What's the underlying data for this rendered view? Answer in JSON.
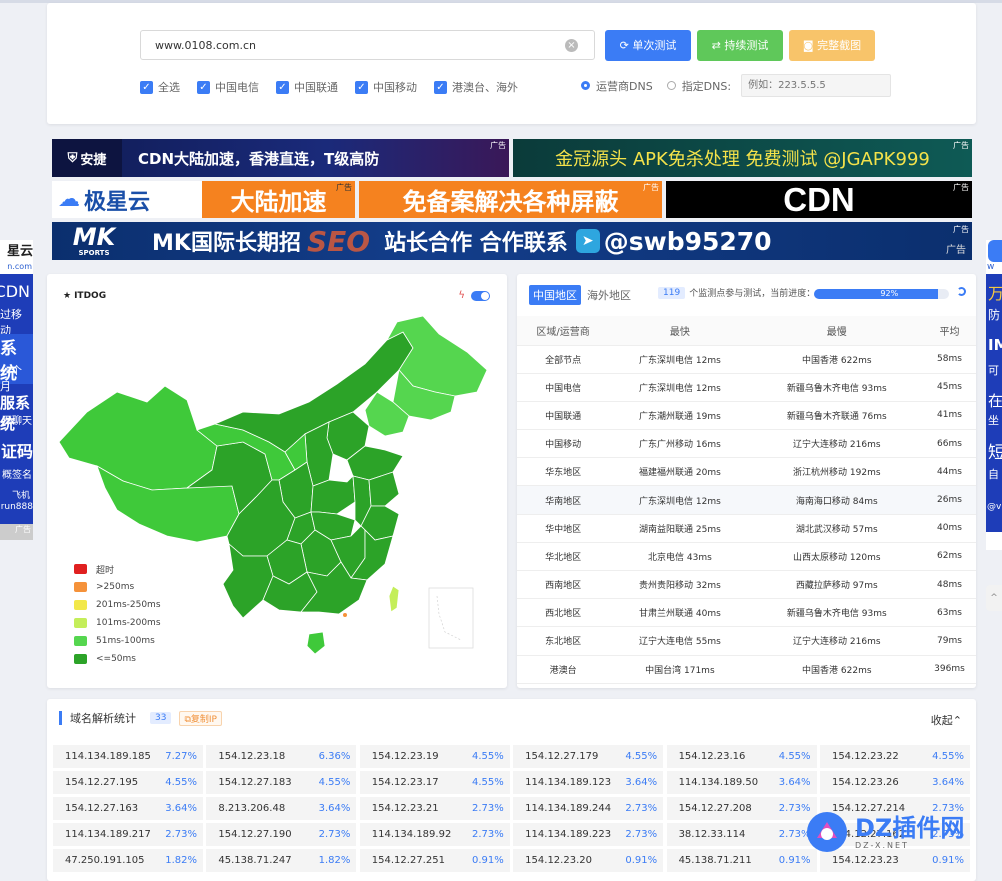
{
  "search": {
    "url_value": "www.0108.com.cn",
    "single_test": "单次测试",
    "continuous_test": "持续测试",
    "full_screenshot": "完整截图",
    "checkboxes": [
      "全选",
      "中国电信",
      "中国联通",
      "中国移动",
      "港澳台、海外"
    ],
    "dns_operator": "运营商DNS",
    "dns_custom": "指定DNS:",
    "dns_placeholder": "例如：223.5.5.5"
  },
  "ads": {
    "tag": "广告",
    "row1_left": "CDN大陆加速，香港直连，T级高防",
    "row1_left_brand": "安捷",
    "row1_right": "金冠源头 APK免杀处理 免费测试 @JGAPK999",
    "row2_left_brand": "极星云",
    "row2_left": "大陆加速",
    "row2_mid": "免备案解决各种屏蔽",
    "row2_right": "CDN",
    "row3_brand": "MK",
    "row3_brand_sub": "SPORTS",
    "row3": "MK国际长期招",
    "row3_seo": "SEO",
    "row3_b": "站长合作 合作联系",
    "row3_handle": "@swb95270",
    "left_side": [
      "星云",
      "n.com",
      "CDN",
      "过移动",
      "系统",
      "一个月",
      "服系统",
      "页聊天",
      "证码",
      "概签名",
      "飞机",
      "run888",
      "广告"
    ],
    "right_side": [
      "w",
      "万",
      "防",
      "IM",
      "可",
      "在",
      "坐",
      "短",
      "自",
      "@v"
    ]
  },
  "map": {
    "logo": "ITDOG",
    "legend": [
      "超时",
      ">250ms",
      "201ms-250ms",
      "101ms-200ms",
      "51ms-100ms",
      "<=50ms"
    ],
    "legend_colors": [
      "#e02020",
      "#f5923a",
      "#f2e84a",
      "#c4ee5a",
      "#55d64f",
      "#2ca328"
    ]
  },
  "stats": {
    "tab_cn": "中国地区",
    "tab_overseas": "海外地区",
    "node_count": "119",
    "node_text": "个监测点参与测试，当前进度：",
    "progress": "92%",
    "progress_value": 0.92,
    "headers": [
      "区域/运营商",
      "最快",
      "最慢",
      "平均"
    ],
    "rows": [
      [
        "全部节点",
        "广东深圳电信 12ms",
        "中国香港 622ms",
        "58ms"
      ],
      [
        "中国电信",
        "广东深圳电信 12ms",
        "新疆乌鲁木齐电信 93ms",
        "45ms"
      ],
      [
        "中国联通",
        "广东潮州联通 19ms",
        "新疆乌鲁木齐联通 76ms",
        "41ms"
      ],
      [
        "中国移动",
        "广东广州移动 16ms",
        "辽宁大连移动 216ms",
        "66ms"
      ],
      [
        "华东地区",
        "福建福州联通 20ms",
        "浙江杭州移动 192ms",
        "44ms"
      ],
      [
        "华南地区",
        "广东深圳电信 12ms",
        "海南海口移动 84ms",
        "26ms"
      ],
      [
        "华中地区",
        "湖南益阳联通 25ms",
        "湖北武汉移动 57ms",
        "40ms"
      ],
      [
        "华北地区",
        "北京电信 43ms",
        "山西太原移动 120ms",
        "62ms"
      ],
      [
        "西南地区",
        "贵州贵阳移动 32ms",
        "西藏拉萨移动 97ms",
        "48ms"
      ],
      [
        "西北地区",
        "甘肃兰州联通 40ms",
        "新疆乌鲁木齐电信 93ms",
        "63ms"
      ],
      [
        "东北地区",
        "辽宁大连电信 55ms",
        "辽宁大连移动 216ms",
        "79ms"
      ],
      [
        "港澳台",
        "中国台湾 171ms",
        "中国香港 622ms",
        "396ms"
      ]
    ]
  },
  "dns_stats": {
    "title": "域名解析统计",
    "count": "33",
    "copy_ip": "复制IP",
    "collapse": "收起",
    "entries": [
      [
        "114.134.189.185",
        "7.27%"
      ],
      [
        "154.12.23.18",
        "6.36%"
      ],
      [
        "154.12.23.19",
        "4.55%"
      ],
      [
        "154.12.27.179",
        "4.55%"
      ],
      [
        "154.12.23.16",
        "4.55%"
      ],
      [
        "154.12.23.22",
        "4.55%"
      ],
      [
        "154.12.27.195",
        "4.55%"
      ],
      [
        "154.12.27.183",
        "4.55%"
      ],
      [
        "154.12.23.17",
        "4.55%"
      ],
      [
        "114.134.189.123",
        "3.64%"
      ],
      [
        "114.134.189.50",
        "3.64%"
      ],
      [
        "154.12.23.26",
        "3.64%"
      ],
      [
        "154.12.27.163",
        "3.64%"
      ],
      [
        "8.213.206.48",
        "3.64%"
      ],
      [
        "154.12.23.21",
        "2.73%"
      ],
      [
        "114.134.189.244",
        "2.73%"
      ],
      [
        "154.12.27.208",
        "2.73%"
      ],
      [
        "154.12.27.214",
        "2.73%"
      ],
      [
        "114.134.189.217",
        "2.73%"
      ],
      [
        "154.12.27.190",
        "2.73%"
      ],
      [
        "114.134.189.92",
        "2.73%"
      ],
      [
        "114.134.189.223",
        "2.73%"
      ],
      [
        "38.12.33.114",
        "2.73%"
      ],
      [
        "154.12.27.162",
        "2.73%"
      ],
      [
        "47.250.191.105",
        "1.82%"
      ],
      [
        "45.138.71.247",
        "1.82%"
      ],
      [
        "154.12.27.251",
        "0.91%"
      ],
      [
        "154.12.23.20",
        "0.91%"
      ],
      [
        "45.138.71.211",
        "0.91%"
      ],
      [
        "154.12.23.23",
        "0.91%"
      ]
    ]
  },
  "watermark": {
    "text": "DZ插件网",
    "sub": "DZ-X.NET"
  }
}
